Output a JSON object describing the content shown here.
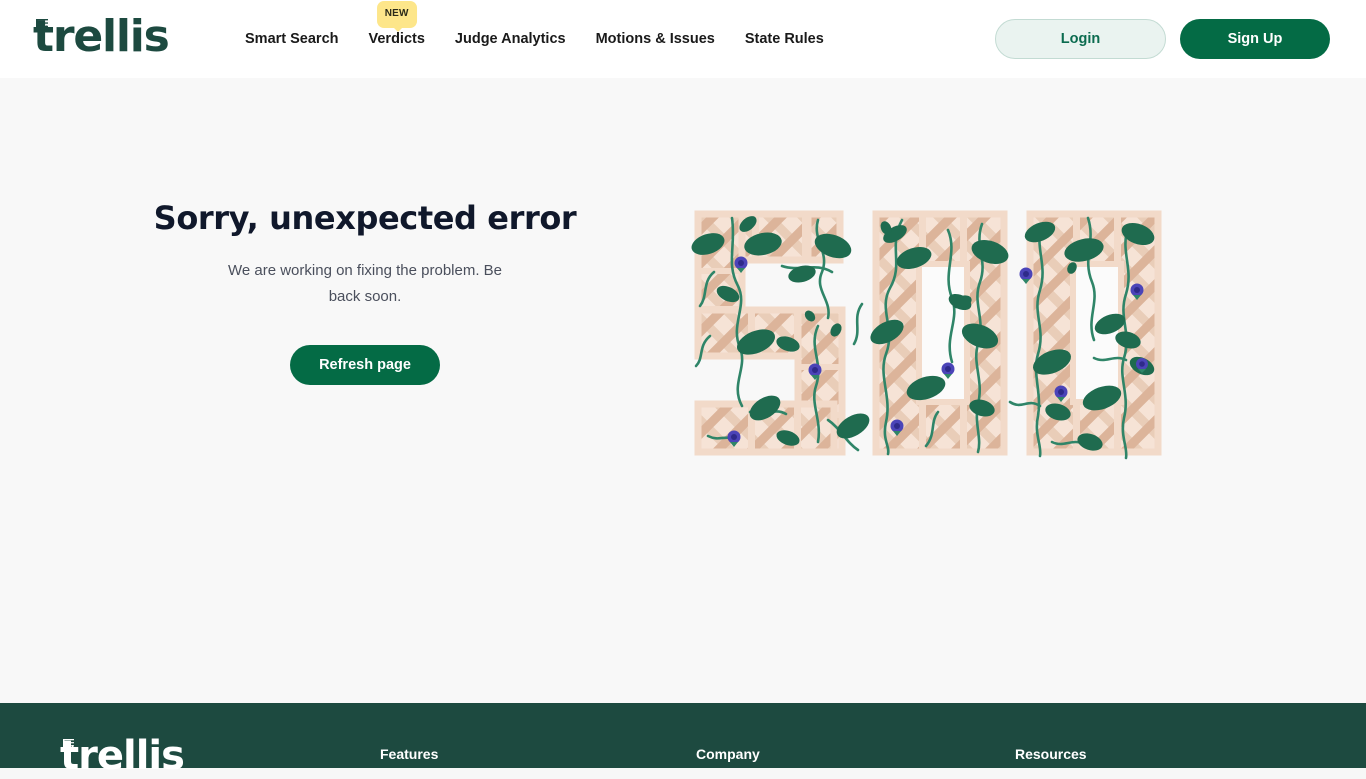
{
  "header": {
    "logo": "trellis",
    "logo_icon": "trellis-lattice-icon",
    "nav": [
      {
        "label": "Smart Search",
        "badge": null
      },
      {
        "label": "Verdicts",
        "badge": "NEW"
      },
      {
        "label": "Judge Analytics",
        "badge": null
      },
      {
        "label": "Motions & Issues",
        "badge": null
      },
      {
        "label": "State Rules",
        "badge": null
      }
    ],
    "login_label": "Login",
    "signup_label": "Sign Up"
  },
  "main": {
    "title": "Sorry, unexpected error",
    "subtitle": "We are working on fixing the problem. Be back soon.",
    "refresh_label": "Refresh page",
    "illustration": {
      "name": "500-trellis-illustration",
      "error_code": "500",
      "description": "The digits 500 rendered as beige garden lattice trellis panels overgrown with green vines, dark green leaves and small purple flowers."
    }
  },
  "footer": {
    "logo": "trellis",
    "columns": [
      {
        "title": "Features"
      },
      {
        "title": "Company"
      },
      {
        "title": "Resources"
      }
    ]
  },
  "colors": {
    "brand_green": "#1d4a40",
    "button_green": "#046b45",
    "login_bg": "#eaf3f0",
    "badge_yellow": "#fde68a",
    "page_bg": "#f8f8f8",
    "lattice_light": "#f4ded0",
    "lattice_mid": "#e8cab5",
    "lattice_dark": "#dbb9a0",
    "leaf_green": "#1f6b4f",
    "vine_green": "#2f8568",
    "flower_purple": "#4b44b8"
  }
}
